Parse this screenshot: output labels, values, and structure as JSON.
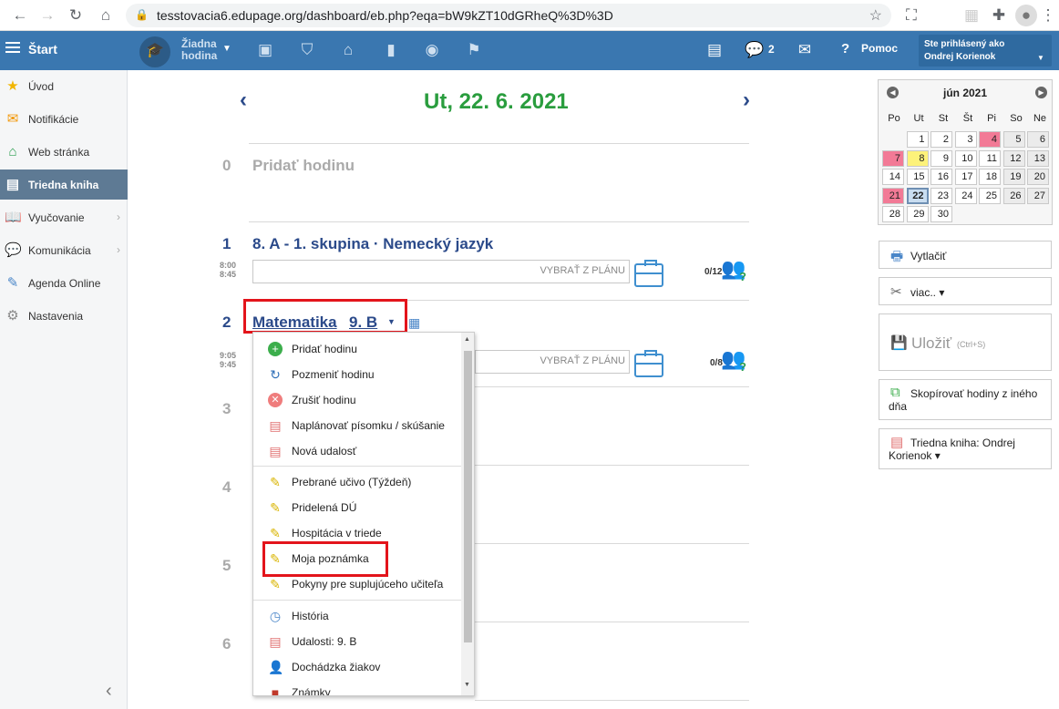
{
  "browser": {
    "url": "tesstovacia6.edupage.org/dashboard/eb.php?eqa=bW9kZT10dGRheQ%3D%3D"
  },
  "header": {
    "start_label": "Štart",
    "lesson_selector": "Žiadna hodina",
    "messages_count": "2",
    "help_label": "Pomoc",
    "login_label": "Ste prihlásený ako",
    "login_user": "Ondrej Korienok"
  },
  "sidebar": {
    "items": [
      {
        "label": "Úvod"
      },
      {
        "label": "Notifikácie"
      },
      {
        "label": "Web stránka"
      },
      {
        "label": "Triedna kniha"
      },
      {
        "label": "Vyučovanie"
      },
      {
        "label": "Komunikácia"
      },
      {
        "label": "Agenda Online"
      },
      {
        "label": "Nastavenia"
      }
    ]
  },
  "main": {
    "date": "Ut, 22. 6. 2021",
    "lessons": [
      {
        "num": "0",
        "title": "Pridať hodinu"
      },
      {
        "num": "1",
        "title": "8. A - 1. skupina · Nemecký jazyk",
        "start": "8:00",
        "end": "8:45",
        "plan": "VYBRAŤ Z PLÁNU",
        "count": "0/12"
      },
      {
        "num": "2",
        "subject": "Matematika",
        "class": "9. B",
        "start": "9:05",
        "end": "9:45",
        "plan": "VYBRAŤ Z PLÁNU",
        "count": "0/8"
      },
      {
        "num": "3"
      },
      {
        "num": "4"
      },
      {
        "num": "5"
      },
      {
        "num": "6"
      }
    ]
  },
  "menu": {
    "items": [
      {
        "label": "Pridať hodinu"
      },
      {
        "label": "Pozmeniť hodinu"
      },
      {
        "label": "Zrušiť hodinu"
      },
      {
        "label": "Naplánovať písomku / skúšanie"
      },
      {
        "label": "Nová udalosť"
      },
      {
        "label": "Prebrané učivo (Týždeň)"
      },
      {
        "label": "Pridelená DÚ"
      },
      {
        "label": "Hospitácia v triede"
      },
      {
        "label": "Moja poznámka"
      },
      {
        "label": "Pokyny pre suplujúceho učiteľa"
      },
      {
        "label": "História"
      },
      {
        "label": "Udalosti: 9. B"
      },
      {
        "label": "Dochádzka žiakov"
      },
      {
        "label": "Známky"
      }
    ]
  },
  "calendar": {
    "month": "jún 2021",
    "days": [
      "Po",
      "Ut",
      "St",
      "Št",
      "Pi",
      "So",
      "Ne"
    ],
    "colors": {
      "pink": "#f27a96",
      "yellow": "#fdf27a",
      "today": "#c9ddf0",
      "weekend": "#ebebeb"
    }
  },
  "right_panel": {
    "print": "Vytlačiť",
    "more": "viac.. ▾",
    "save": "Uložiť",
    "save_hint": "(Ctrl+S)",
    "copy": "Skopírovať hodiny z iného dňa",
    "classbook": "Triedna kniha: Ondrej Korienok ▾"
  },
  "colors": {
    "accent": "#3a77b0",
    "date_green": "#2a9d3e",
    "highlight_red": "#e3141b"
  }
}
